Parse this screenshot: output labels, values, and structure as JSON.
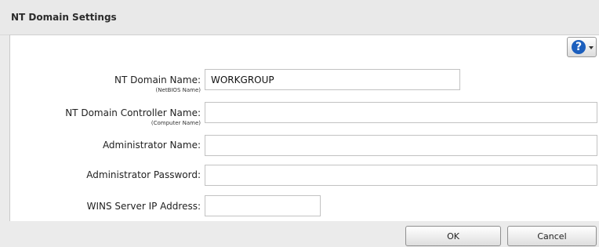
{
  "dialog": {
    "title": "NT Domain Settings",
    "help_icon": "question-circle-icon"
  },
  "form": {
    "nt_domain_name": {
      "label": "NT Domain Name:",
      "sublabel": "(NetBIOS Name)",
      "value": "WORKGROUP"
    },
    "nt_domain_controller_name": {
      "label": "NT Domain Controller Name:",
      "sublabel": "(Computer Name)",
      "value": ""
    },
    "administrator_name": {
      "label": "Administrator Name:",
      "value": ""
    },
    "administrator_password": {
      "label": "Administrator Password:",
      "value": ""
    },
    "wins_server_ip": {
      "label": "WINS Server IP Address:",
      "value": ""
    }
  },
  "buttons": {
    "ok": "OK",
    "cancel": "Cancel"
  }
}
